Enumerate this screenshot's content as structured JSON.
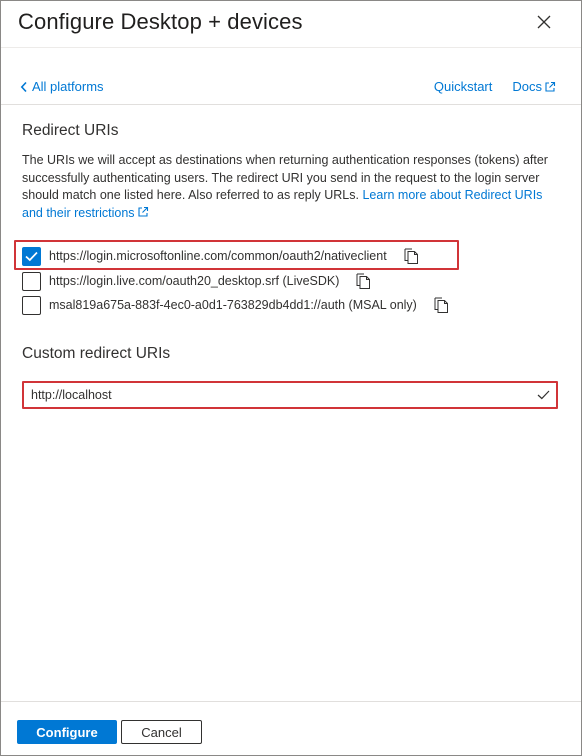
{
  "header": {
    "title": "Configure Desktop + devices",
    "close_icon": "close-icon"
  },
  "nav": {
    "back_label": "All platforms",
    "quickstart_label": "Quickstart",
    "docs_label": "Docs"
  },
  "redirect_uris": {
    "heading": "Redirect URIs",
    "description": "The URIs we will accept as destinations when returning authentication responses (tokens) after successfully authenticating users. The redirect URI you send in the request to the login server should match one listed here. Also referred to as reply URLs.",
    "learn_more_label": "Learn more about Redirect URIs and their restrictions",
    "items": [
      {
        "label": "https://login.microsoftonline.com/common/oauth2/nativeclient",
        "checked": true
      },
      {
        "label": "https://login.live.com/oauth20_desktop.srf (LiveSDK)",
        "checked": false
      },
      {
        "label": "msal819a675a-883f-4ec0-a0d1-763829db4dd1://auth (MSAL only)",
        "checked": false
      }
    ]
  },
  "custom_redirect": {
    "heading": "Custom redirect URIs",
    "value": "http://localhost"
  },
  "footer": {
    "configure_label": "Configure",
    "cancel_label": "Cancel"
  },
  "colors": {
    "accent": "#0078d4",
    "highlight": "#d13438",
    "text": "#323130"
  }
}
